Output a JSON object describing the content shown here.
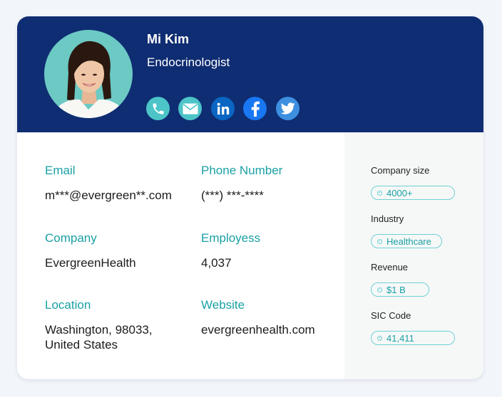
{
  "profile": {
    "name": "Mi Kim",
    "title": "Endocrinologist"
  },
  "socials": [
    {
      "icon": "phone-icon",
      "color": "#4cc4c8"
    },
    {
      "icon": "mail-icon",
      "color": "#4cc4c8"
    },
    {
      "icon": "linkedin-icon",
      "color": "#0a66c2"
    },
    {
      "icon": "facebook-icon",
      "color": "#1877f2"
    },
    {
      "icon": "twitter-icon",
      "color": "#3d8fe0"
    }
  ],
  "details": {
    "email": {
      "label": "Email",
      "value": "m***@evergreen**.com"
    },
    "phone": {
      "label": "Phone Number",
      "value": "(***) ***-****"
    },
    "company": {
      "label": "Company",
      "value": "EvergreenHealth"
    },
    "employees": {
      "label": "Employess",
      "value": "4,037"
    },
    "location": {
      "label": "Location",
      "line1": "Washington, 98033,",
      "line2": "United States"
    },
    "website": {
      "label": "Website",
      "value": "evergreenhealth.com"
    }
  },
  "sidebar": {
    "company_size": {
      "label": "Company size",
      "value": "4000+"
    },
    "industry": {
      "label": "Industry",
      "value": "Healthcare"
    },
    "revenue": {
      "label": "Revenue",
      "value": "$1 B"
    },
    "sic_code": {
      "label": "SIC Code",
      "value": "41,411"
    }
  },
  "colors": {
    "header": "#0f2d72",
    "accent": "#1aa0a5",
    "pill_border": "#6fd0d4"
  }
}
